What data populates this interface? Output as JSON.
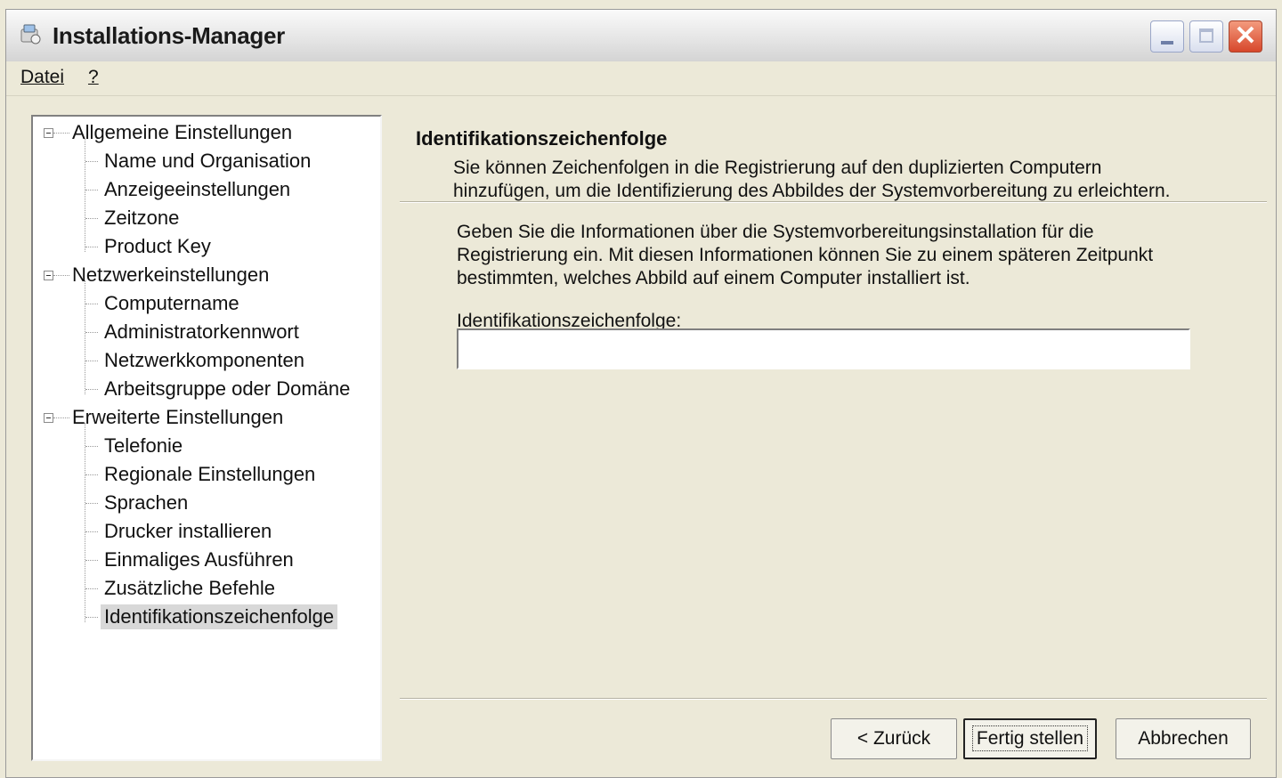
{
  "window": {
    "title": "Installations-Manager"
  },
  "menu": {
    "items": [
      "Datei",
      "?"
    ]
  },
  "tree": {
    "groups": [
      {
        "label": "Allgemeine Einstellungen",
        "children": [
          "Name und Organisation",
          "Anzeigeeinstellungen",
          "Zeitzone",
          "Product Key"
        ]
      },
      {
        "label": "Netzwerkeinstellungen",
        "children": [
          "Computername",
          "Administratorkennwort",
          "Netzwerkkomponenten",
          "Arbeitsgruppe oder Domäne"
        ]
      },
      {
        "label": "Erweiterte Einstellungen",
        "children": [
          "Telefonie",
          "Regionale Einstellungen",
          "Sprachen",
          "Drucker installieren",
          "Einmaliges Ausführen",
          "Zusätzliche Befehle",
          "Identifikationszeichenfolge"
        ]
      }
    ],
    "selected": "Identifikationszeichenfolge"
  },
  "page": {
    "heading": "Identifikationszeichenfolge",
    "description_lines": [
      "Sie können Zeichenfolgen in die Registrierung auf den duplizierten Computern",
      "hinzufügen, um die Identifizierung des Abbildes der Systemvorbereitung zu erleichtern."
    ],
    "body_lines": [
      "Geben Sie die Informationen über die Systemvorbereitungsinstallation für die",
      "Registrierung ein. Mit diesen Informationen können Sie zu einem späteren Zeitpunkt",
      "bestimmten, welches Abbild auf einem Computer installiert ist."
    ],
    "field_label": "Identifikationszeichenfolge:",
    "field_value": ""
  },
  "buttons": {
    "back": "< Zurück",
    "finish": "Fertig stellen",
    "cancel": "Abbrechen"
  }
}
